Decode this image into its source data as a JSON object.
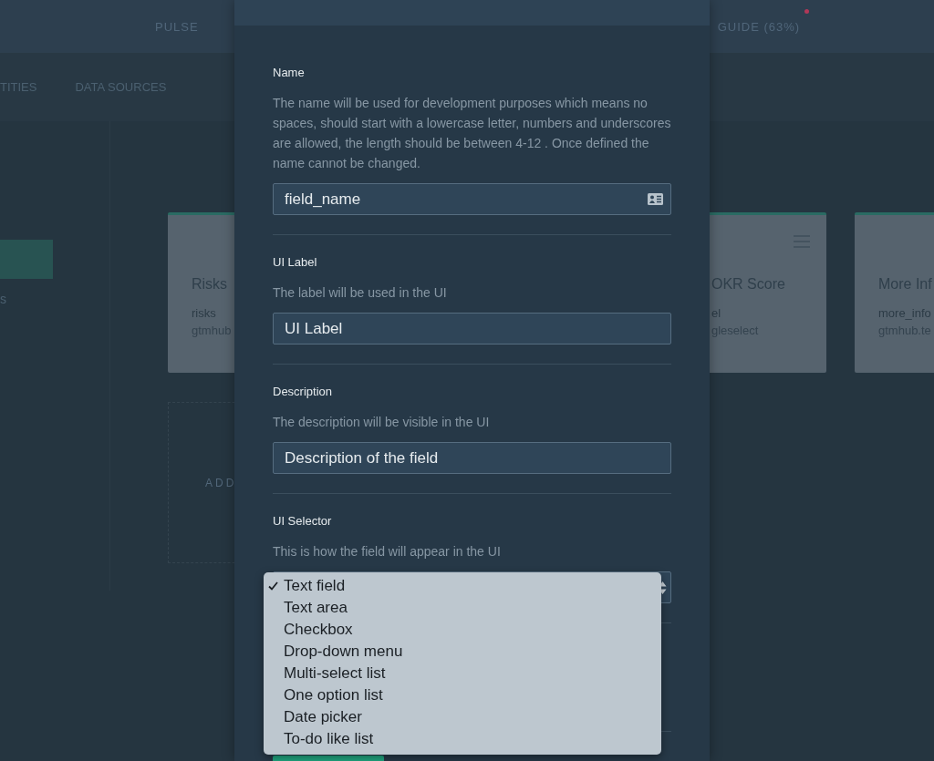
{
  "top_nav": [
    {
      "label": "PULSE"
    },
    {
      "label": "GUIDE (63%)",
      "notification": true
    }
  ],
  "sub_nav": [
    "TITIES",
    "DATA SOURCES"
  ],
  "sidebar": {
    "items": [
      {
        "selected": true
      },
      {
        "label": "s",
        "selected": false
      }
    ]
  },
  "cards": [
    {
      "kind": "covered_right",
      "title": "Risks",
      "name": "risks",
      "source": "gtmhub"
    },
    {
      "kind": "hidden"
    },
    {
      "kind": "covered_left",
      "title": "OKR Score",
      "name": "el",
      "source": "gleselect",
      "menu": true
    },
    {
      "kind": "covered_right",
      "title": "More Inf",
      "name": "more_info",
      "source": "gtmhub.te"
    }
  ],
  "add_card": {
    "label": "ADD"
  },
  "modal": {
    "sections": [
      {
        "kind": "id_input",
        "label": "Name",
        "description": "The name will be used for development purposes which means no spaces, should start with a lowercase letter, numbers and underscores are allowed, the length should be between 4-12 . Once defined the name cannot be changed.",
        "value": "field_name"
      },
      {
        "kind": "input",
        "label": "UI Label",
        "description": "The label will be used in the UI",
        "value": "UI Label"
      },
      {
        "kind": "input",
        "label": "Description",
        "description": "The description will be visible in the UI",
        "value": "Description of the field"
      },
      {
        "kind": "select",
        "label": "UI Selector",
        "description": "This is how the field will appear in the UI",
        "options": [
          {
            "label": "Text field",
            "selected": true
          },
          {
            "label": "Text area",
            "selected": false
          },
          {
            "label": "Checkbox",
            "selected": false
          },
          {
            "label": "Drop-down menu",
            "selected": false
          },
          {
            "label": "Multi-select list",
            "selected": false
          },
          {
            "label": "One option list",
            "selected": false
          },
          {
            "label": "Date picker",
            "selected": false
          },
          {
            "label": "To-do like list",
            "selected": false
          }
        ]
      }
    ]
  }
}
